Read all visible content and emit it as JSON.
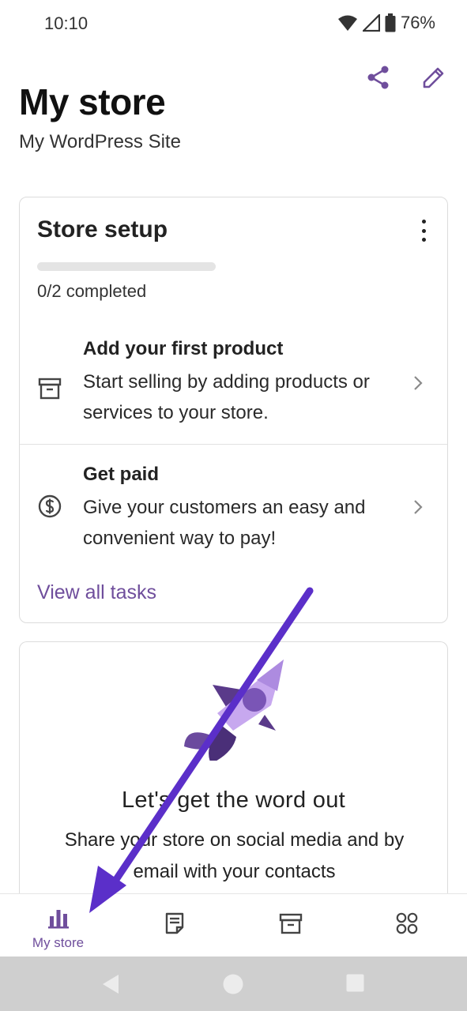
{
  "status_bar": {
    "time": "10:10",
    "battery": "76%"
  },
  "header": {
    "title": "My store",
    "subtitle": "My WordPress Site"
  },
  "setup": {
    "title": "Store setup",
    "progress_fraction": 0,
    "progress_text": "0/2 completed",
    "tasks": [
      {
        "title": "Add your first product",
        "description": "Start selling by adding products or services to your store.",
        "icon": "archive-box-icon"
      },
      {
        "title": "Get paid",
        "description": "Give your customers an easy and convenient way to pay!",
        "icon": "dollar-circle-icon"
      }
    ],
    "view_all": "View all tasks"
  },
  "promo": {
    "title": "Let's get the word out",
    "description": "Share your store on social media and by email with your contacts",
    "icon": "rocket-illustration"
  },
  "bottom_nav": {
    "items": [
      {
        "label": "My store",
        "icon": "bar-chart-icon",
        "active": true
      },
      {
        "label": "",
        "icon": "orders-icon"
      },
      {
        "label": "",
        "icon": "products-icon"
      },
      {
        "label": "",
        "icon": "menu-grid-icon"
      }
    ]
  },
  "colors": {
    "accent": "#6f4e9c",
    "brand_purple": "#7f54b3",
    "annotation_arrow": "#5b2fc9"
  }
}
